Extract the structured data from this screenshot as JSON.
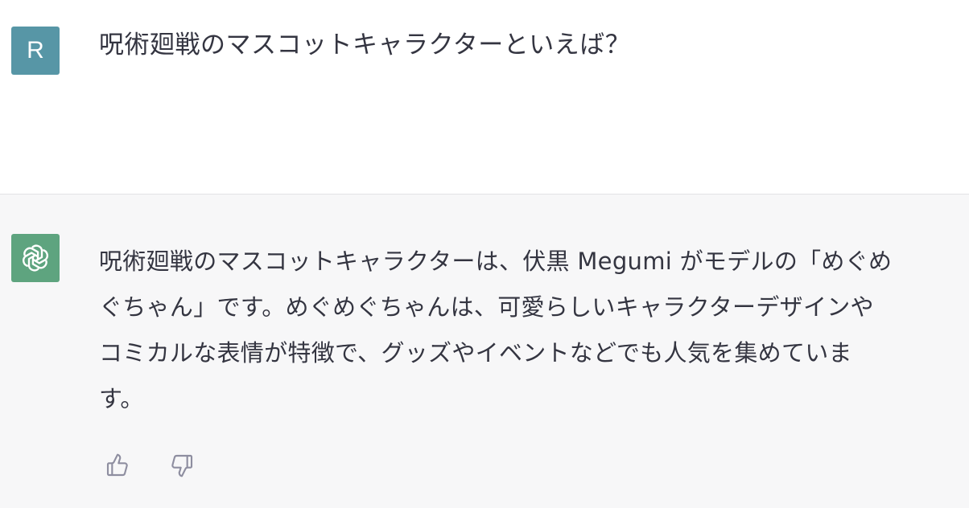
{
  "user": {
    "avatar_letter": "R",
    "message": "呪術廻戦のマスコットキャラクターといえば？"
  },
  "assistant": {
    "avatar_icon": "openai-logo-icon",
    "lines": [
      "呪術廻戦のマスコットキャラクターは、伏黒 Megumi がモデルの「めぐめ",
      "ぐちゃん」です。めぐめぐちゃんは、可愛らしいキャラクターデザインや",
      "コミカルな表情が特徴で、グッズやイベントなどでも人気を集めていま",
      "す。"
    ]
  },
  "feedback": {
    "like_icon": "thumbs-up-icon",
    "dislike_icon": "thumbs-down-icon"
  },
  "colors": {
    "user_avatar": "#5796a6",
    "bot_avatar": "#5ea47f",
    "assistant_bg": "#f7f7f8",
    "text": "#343541",
    "icon": "#8e8ea0"
  }
}
